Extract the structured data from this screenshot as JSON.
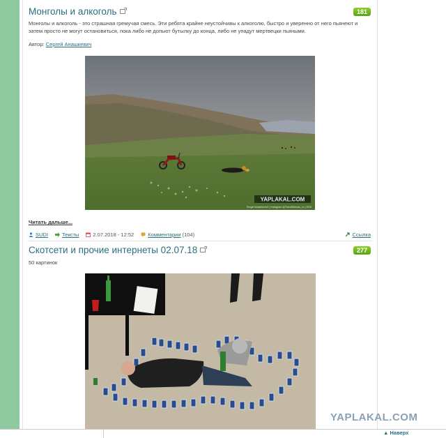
{
  "post1": {
    "title": "Монголы и алкоголь",
    "rating": "181",
    "description": "Монголы и алкоголь - это страшная гремучая смесь. Эти ребята крайне неустойчивы к алкоголю, быстро и уверенно от него пьянеют и затем просто не могут остановиться, пока либо не допьют бутылку до конца, либо не упадут мертвецки пьяными.",
    "author_label": "Автор:",
    "author_name": "Сергей Анашкевич",
    "image_watermark": "YAPLAKAL.COM",
    "image_caption": "Sergei Anashkevich | Instagram @TravelMaman_ru | 2018",
    "read_more": "Читать дальше...",
    "meta": {
      "user": "SUDI",
      "category": "Тексты",
      "datetime": "2.07.2018 - 12:52",
      "comments_label": "Комментарии",
      "comments_count": "(104)",
      "link_label": "Ссылка"
    }
  },
  "post2": {
    "title": "Скотсети и прочие интернеты 02.07.18",
    "rating": "277",
    "subtitle": "50 картинок"
  },
  "page": {
    "watermark": "YAPLAKAL.COM",
    "to_top": "▲ Наверх"
  },
  "colors": {
    "left_band": "#8ec9a0",
    "title": "#2a6f80",
    "rating_bg": "#6cb41c"
  }
}
